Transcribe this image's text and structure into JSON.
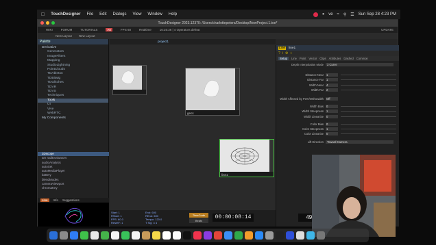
{
  "menubar": {
    "app_name": "TouchDesigner",
    "menus": [
      "File",
      "Edit",
      "Dialogs",
      "View",
      "Window",
      "Help"
    ],
    "status_right": "ve",
    "datetime": "Sun Sep 28  4:23 PM"
  },
  "window": {
    "title": "TouchDesigner 2023.12370: /Users/charlottepeters/Desktop/NewProject.1.toe*",
    "toolbar_items": [
      "WIKI",
      "FORUM",
      "TUTORIALS"
    ],
    "badge": "A5",
    "fps_label": "FPS  60",
    "realtime": "Realtime",
    "op_info": "16:25:36 | 4 Operators defeat",
    "update_label": "UPDATE",
    "tabs": [
      "New Layout",
      "New Layout"
    ]
  },
  "palette": {
    "title": "Palette",
    "tree": [
      {
        "label": "Derivative",
        "top": true
      },
      {
        "label": "Generators"
      },
      {
        "label": "ImageFilters"
      },
      {
        "label": "Mapping"
      },
      {
        "label": "StudioLightning"
      },
      {
        "label": "PointClouds"
      },
      {
        "label": "TDAbleton"
      },
      {
        "label": "TDBitwig"
      },
      {
        "label": "TDGlitches"
      },
      {
        "label": "TDVR"
      },
      {
        "label": "TDVS"
      },
      {
        "label": "Techniques"
      },
      {
        "label": "Tools",
        "selected": true
      },
      {
        "label": "UI"
      },
      {
        "label": "Vive"
      },
      {
        "label": "WebRTC"
      },
      {
        "label": "My Components",
        "top": true
      }
    ],
    "list": [
      {
        "label": "3Dscope",
        "selected": true
      },
      {
        "label": "am radiEvaluators"
      },
      {
        "label": "audioAnalysis"
      },
      {
        "label": "autoSet"
      },
      {
        "label": "autoMediaPlayer"
      },
      {
        "label": "battery"
      },
      {
        "label": "blendModes"
      },
      {
        "label": "cameraViewport"
      },
      {
        "label": "chromaKey"
      }
    ],
    "bottom_tabs": [
      "Line",
      "Info",
      "Suggestions"
    ]
  },
  "network": {
    "path": "project1",
    "nodes": [
      {
        "id": "n1",
        "name": ""
      },
      {
        "id": "n2",
        "name": "geo1"
      },
      {
        "id": "n3",
        "name": "line1"
      }
    ]
  },
  "params": {
    "title": "line1",
    "op_type": "Line",
    "tabs": [
      "Setup",
      "Line",
      "Point",
      "Vector",
      "Clips",
      "Attributes",
      "Dashed",
      "Common"
    ],
    "rows": [
      {
        "label": "Depth Interpolation Mode",
        "type": "dropdown",
        "value": "3 Curve"
      },
      {
        "label": "Distance Near",
        "type": "num",
        "value": "1"
      },
      {
        "label": "Distance Far",
        "type": "num",
        "value": "1"
      },
      {
        "label": "Width Near",
        "type": "num",
        "value": "4"
      },
      {
        "label": "Width Far",
        "type": "num",
        "value": "2"
      },
      {
        "label": "Width Affected by FOV/Orthowidth",
        "type": "toggle",
        "value": "Off"
      },
      {
        "label": "Width Bias",
        "type": "num",
        "value": "0"
      },
      {
        "label": "Width Steepness",
        "type": "num",
        "value": "1"
      },
      {
        "label": "Width Linearize",
        "type": "num",
        "value": "0"
      },
      {
        "label": "Color Bias",
        "type": "num",
        "value": "0"
      },
      {
        "label": "Color Steepness",
        "type": "num",
        "value": "1"
      },
      {
        "label": "Color Linearize",
        "type": "num",
        "value": "0"
      },
      {
        "label": "Lift Direction",
        "type": "dropdown",
        "value": "Toward Camera"
      }
    ]
  },
  "timeline": {
    "stats": [
      "Start:  1",
      "RStart: 1",
      "FPS:  60.0",
      "ResetF: 1",
      "End:  600",
      "REnd:  600",
      "Tempo: 120.0",
      "T Sig:  4  4"
    ],
    "timecode_label": "TimeCode",
    "beats_label": "Beats",
    "timecode": "00:00:08:14",
    "frame": "495"
  }
}
